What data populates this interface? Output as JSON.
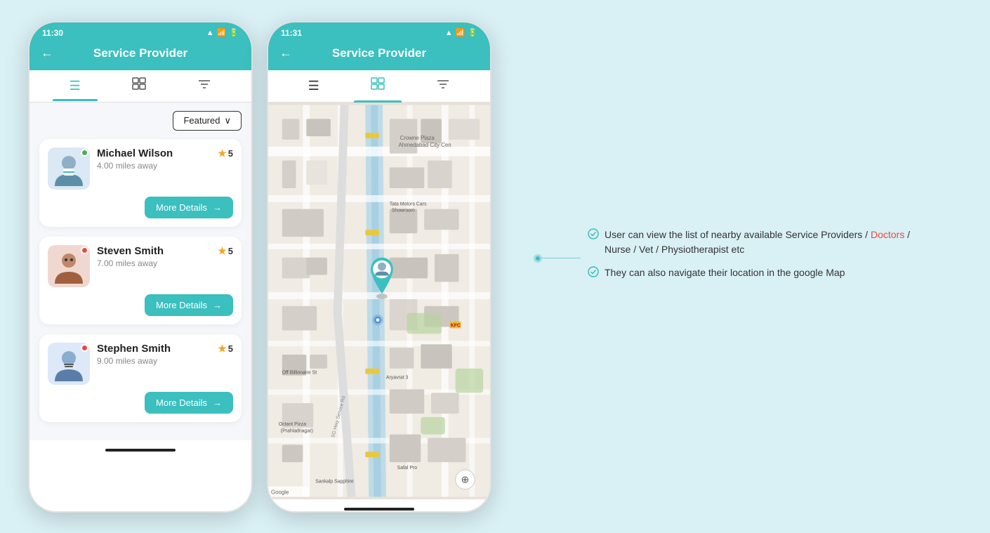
{
  "phone_left": {
    "status_bar": {
      "time": "11:30",
      "icons": "▲ ⬛ 📶 🔋"
    },
    "header": {
      "back": "←",
      "title": "Service Provider"
    },
    "tabs": [
      {
        "id": "list",
        "icon": "≡",
        "active": true
      },
      {
        "id": "grid",
        "icon": "⊞",
        "active": false
      },
      {
        "id": "filter",
        "icon": "⚙",
        "active": false
      }
    ],
    "featured_label": "Featured",
    "providers": [
      {
        "name": "Michael Wilson",
        "distance": "4.00 miles away",
        "rating": "5",
        "status": "online",
        "btn": "More Details"
      },
      {
        "name": "Steven Smith",
        "distance": "7.00 miles away",
        "rating": "5",
        "status": "offline",
        "btn": "More Details"
      },
      {
        "name": "Stephen Smith",
        "distance": "9.00 miles away",
        "rating": "5",
        "status": "offline",
        "btn": "More Details"
      }
    ]
  },
  "phone_right": {
    "status_bar": {
      "time": "11:31"
    },
    "header": {
      "back": "←",
      "title": "Service Provider"
    },
    "tabs": [
      {
        "id": "list",
        "icon": "≡",
        "active": false
      },
      {
        "id": "grid",
        "icon": "⊞",
        "active": true
      },
      {
        "id": "filter",
        "icon": "⚙",
        "active": false
      }
    ]
  },
  "info": {
    "bullet1": "User can view the list of nearby available Service Providers / Doctors / Nurse / Vet / Physiotherapist etc",
    "bullet1_highlight": "Doctors",
    "bullet2": "They can also navigate their location in the google Map",
    "doctors_label": "Doctors"
  },
  "icons": {
    "back_arrow": "←",
    "star": "★",
    "arrow_right": "→",
    "check": "✓",
    "chevron_down": "∨"
  }
}
